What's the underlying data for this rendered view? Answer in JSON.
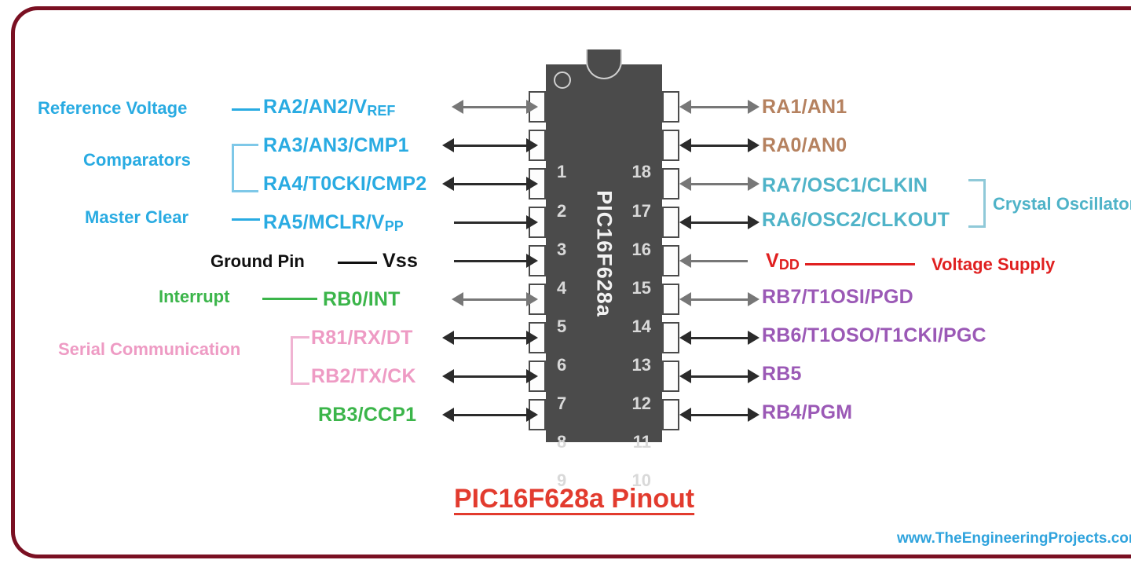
{
  "title": "PIC16F628a Pinout",
  "watermark": "www.TheEngineeringProjects.com",
  "chip": {
    "name": "PIC16F628a",
    "package": "DIP-18",
    "body_color": "#4b4b4b",
    "left_pin_numbers": [
      "1",
      "2",
      "3",
      "4",
      "5",
      "6",
      "7",
      "8",
      "9"
    ],
    "right_pin_numbers": [
      "18",
      "17",
      "16",
      "15",
      "14",
      "13",
      "12",
      "11",
      "10"
    ]
  },
  "colors": {
    "frame": "#7a1022",
    "blue": "#29ABE2",
    "teal": "#4FB3C8",
    "brown": "#B5815F",
    "green": "#3BB54A",
    "pink": "#EE9BC4",
    "purple": "#9B59B6",
    "red": "#E02020",
    "black": "#111111",
    "title": "#e23b2e",
    "watermark": "#2fa3dd"
  },
  "left_pins": [
    {
      "num": "1",
      "signal_pre": "RA2/AN2/V",
      "signal_sub": "REF",
      "color": "blue",
      "arrow": "both"
    },
    {
      "num": "2",
      "signal_pre": "RA3/AN3/CMP1",
      "signal_sub": "",
      "color": "blue",
      "arrow": "both"
    },
    {
      "num": "3",
      "signal_pre": "RA4/T0CKI/CMP2",
      "signal_sub": "",
      "color": "blue",
      "arrow": "both"
    },
    {
      "num": "4",
      "signal_pre": "RA5/MCLR/V",
      "signal_sub": "PP",
      "color": "blue",
      "arrow": "in"
    },
    {
      "num": "5",
      "signal_pre": "Vss",
      "signal_sub": "",
      "color": "black",
      "arrow": "in"
    },
    {
      "num": "6",
      "signal_pre": "RB0/INT",
      "signal_sub": "",
      "color": "green",
      "arrow": "both"
    },
    {
      "num": "7",
      "signal_pre": "R81/RX/DT",
      "signal_sub": "",
      "color": "pink",
      "arrow": "both"
    },
    {
      "num": "8",
      "signal_pre": "RB2/TX/CK",
      "signal_sub": "",
      "color": "pink",
      "arrow": "both"
    },
    {
      "num": "9",
      "signal_pre": "RB3/CCP1",
      "signal_sub": "",
      "color": "green",
      "arrow": "both"
    }
  ],
  "right_pins": [
    {
      "num": "18",
      "signal_pre": "RA1/AN1",
      "signal_sub": "",
      "color": "brown",
      "arrow": "both"
    },
    {
      "num": "17",
      "signal_pre": "RA0/AN0",
      "signal_sub": "",
      "color": "brown",
      "arrow": "both"
    },
    {
      "num": "16",
      "signal_pre": "RA7/OSC1/CLKIN",
      "signal_sub": "",
      "color": "teal",
      "arrow": "both"
    },
    {
      "num": "15",
      "signal_pre": "RA6/OSC2/CLKOUT",
      "signal_sub": "",
      "color": "teal",
      "arrow": "both"
    },
    {
      "num": "14",
      "signal_pre": "V",
      "signal_sub": "DD",
      "color": "red",
      "arrow": "out"
    },
    {
      "num": "13",
      "signal_pre": "RB7/T1OSI/PGD",
      "signal_sub": "",
      "color": "purple",
      "arrow": "both"
    },
    {
      "num": "12",
      "signal_pre": "RB6/T1OSO/T1CKI/PGC",
      "signal_sub": "",
      "color": "purple",
      "arrow": "both"
    },
    {
      "num": "11",
      "signal_pre": "RB5",
      "signal_sub": "",
      "color": "purple",
      "arrow": "both"
    },
    {
      "num": "10",
      "signal_pre": "RB4/PGM",
      "signal_sub": "",
      "color": "purple",
      "arrow": "both"
    }
  ],
  "functions": {
    "reference_voltage": "Reference Voltage",
    "comparators": "Comparators",
    "master_clear": "Master Clear",
    "ground_pin": "Ground Pin",
    "interrupt": "Interrupt",
    "serial_communication": "Serial Communication",
    "crystal_oscillator": "Crystal Oscillator",
    "voltage_supply": "Voltage Supply"
  }
}
